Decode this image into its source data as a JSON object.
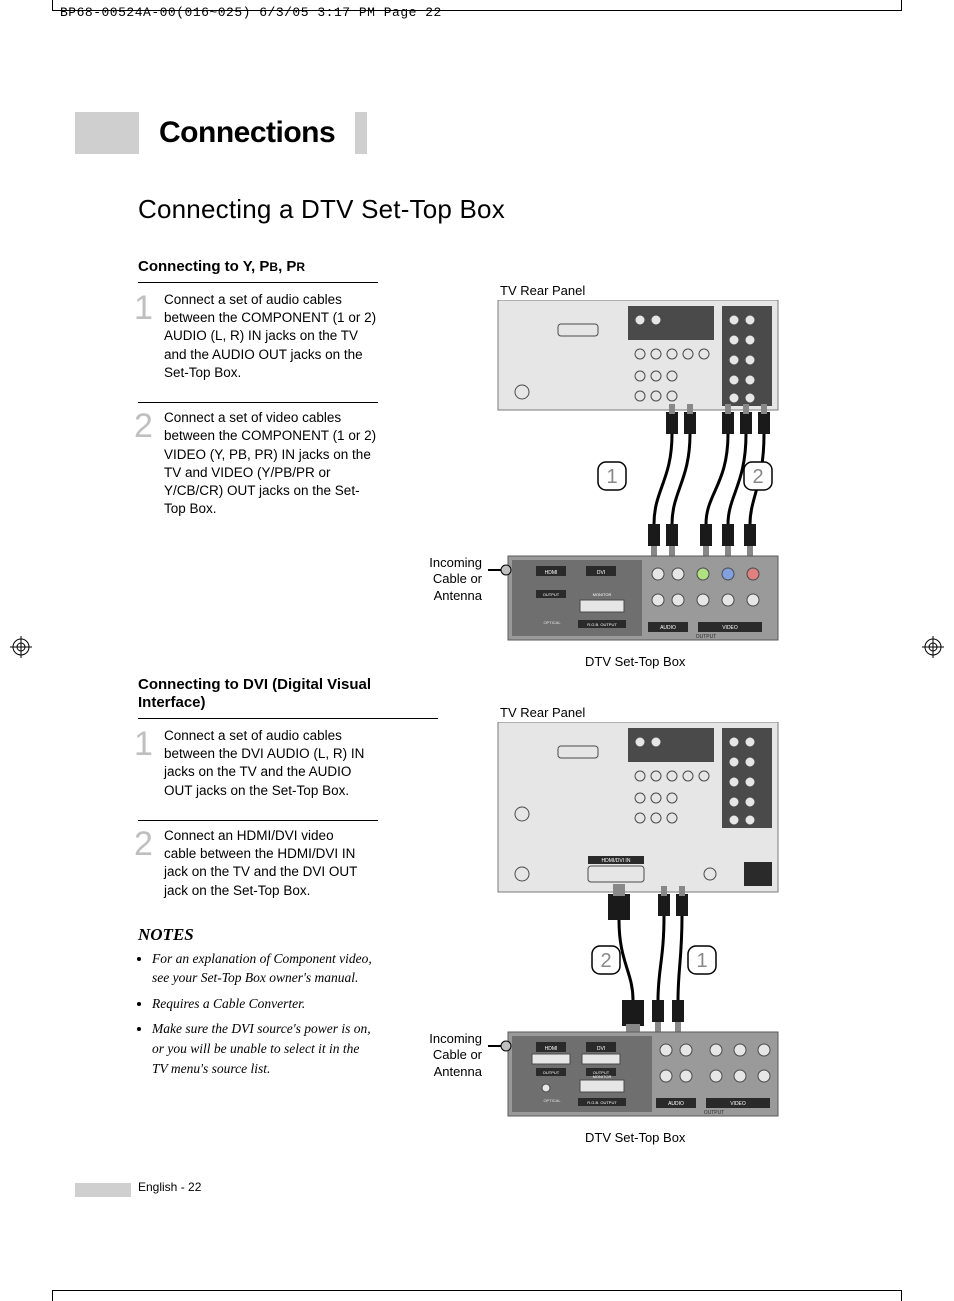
{
  "header": "BP68-00524A-00(016~025)  6/3/05  3:17 PM  Page 22",
  "section_title": "Connections",
  "page_title": "Connecting a DTV Set-Top Box",
  "blockA": {
    "subhead_prefix": "Connecting to Y, P",
    "subhead_b": "B",
    "subhead_mid": ", P",
    "subhead_r": "R",
    "step1": "Connect a set of audio cables between the COMPONENT (1 or 2) AUDIO (L, R) IN jacks on the TV and the AUDIO OUT jacks on the Set-Top Box.",
    "step2": "Connect a set of video cables between the COMPONENT (1 or 2) VIDEO (Y, PB, PR) IN jacks on the TV and VIDEO (Y/PB/PR or Y/CB/CR) OUT jacks on the Set-Top Box."
  },
  "blockB": {
    "subhead": "Connecting to DVI (Digital Visual Interface)",
    "step1": "Connect a set of audio cables between the DVI AUDIO (L, R) IN jacks on the TV and the AUDIO OUT jacks on the Set-Top Box.",
    "step2": "Connect an HDMI/DVI video cable between the HDMI/DVI IN jack on the TV and the DVI OUT jack on the Set-Top Box."
  },
  "notes_heading": "NOTES",
  "notes": [
    "For an explanation of Component video, see your Set-Top Box owner's manual.",
    "Requires a Cable Converter.",
    "Make sure the DVI source's power is on, or you will be unable to select it in the TV menu's source list."
  ],
  "labels": {
    "tv_rear": "TV Rear Panel",
    "incoming": "Incoming Cable or Antenna",
    "stb": "DTV Set-Top Box"
  },
  "callouts": {
    "one": "1",
    "two": "2"
  },
  "footer": "English - 22"
}
